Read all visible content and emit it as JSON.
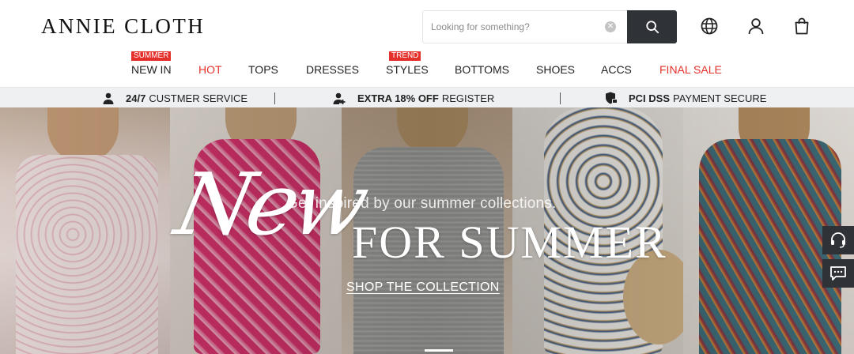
{
  "brand": {
    "logo": "ANNIE CLOTH"
  },
  "search": {
    "placeholder": "Looking for something?",
    "value": ""
  },
  "header_icons": [
    "globe-icon",
    "user-icon",
    "bag-icon",
    "search-icon",
    "clear-icon"
  ],
  "nav": {
    "items": [
      {
        "label": "NEW IN",
        "badge": "SUMMER",
        "highlight": false
      },
      {
        "label": "HOT",
        "badge": "",
        "highlight": true
      },
      {
        "label": "TOPS",
        "badge": "",
        "highlight": false
      },
      {
        "label": "DRESSES",
        "badge": "",
        "highlight": false
      },
      {
        "label": "STYLES",
        "badge": "TREND",
        "highlight": false
      },
      {
        "label": "BOTTOMS",
        "badge": "",
        "highlight": false
      },
      {
        "label": "SHOES",
        "badge": "",
        "highlight": false
      },
      {
        "label": "ACCS",
        "badge": "",
        "highlight": false
      },
      {
        "label": "FINAL SALE",
        "badge": "",
        "highlight": true
      }
    ]
  },
  "service_bar": [
    {
      "bold": "24/7",
      "text": "CUSTMER SERVICE",
      "icon": "headset-person-icon"
    },
    {
      "bold": "EXTRA 18% OFF",
      "text": "REGISTER",
      "icon": "user-plus-icon"
    },
    {
      "bold": "PCI DSS",
      "text": "PAYMENT SECURE",
      "icon": "shield-lock-icon"
    }
  ],
  "hero": {
    "script_text": "New",
    "tagline": "Get inspired by our summer collections.",
    "headline": "FOR SUMMER",
    "cta": "SHOP THE COLLECTION"
  },
  "floating": [
    "customer-service-icon",
    "chat-icon"
  ],
  "colors": {
    "accent_red": "#e4312b",
    "dark": "#2f3338",
    "service_bg": "#eef0f2"
  }
}
